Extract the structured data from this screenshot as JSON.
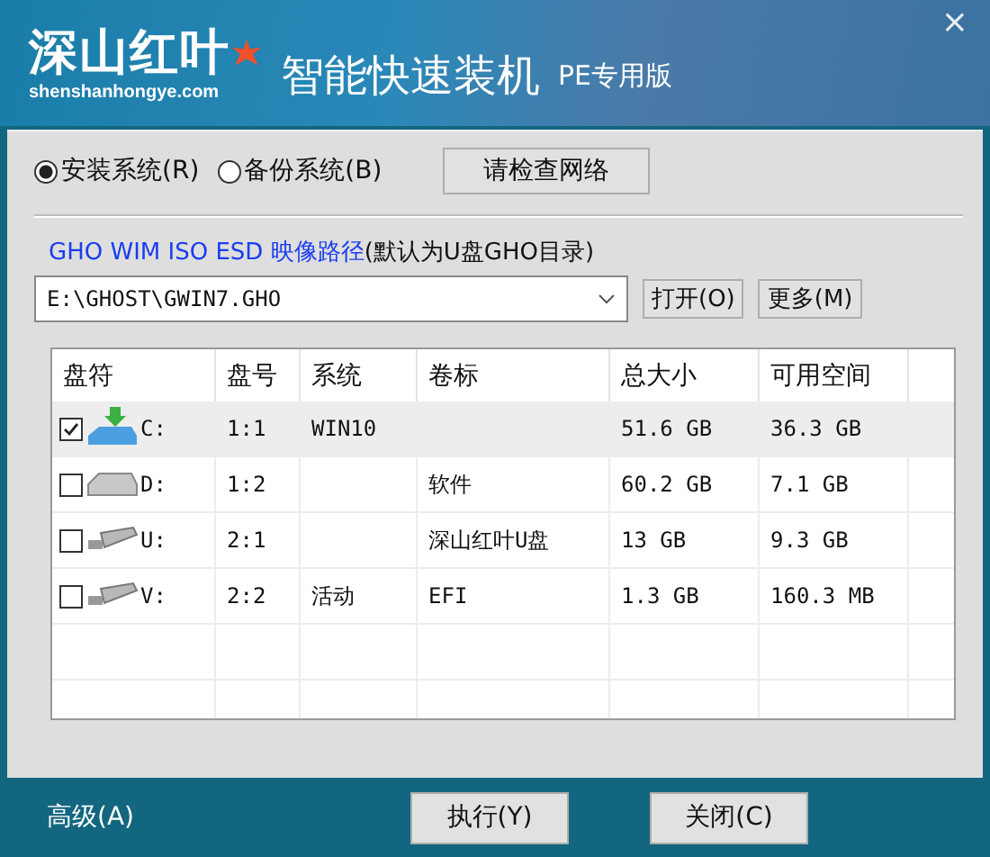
{
  "header": {
    "logo": "深山红叶",
    "website": "shenshanhongye.com",
    "title": "智能快速装机",
    "edition": "PE专用版",
    "close": "×"
  },
  "modes": [
    {
      "label": "安装系统(R)",
      "selected": true
    },
    {
      "label": "备份系统(B)",
      "selected": false
    }
  ],
  "network_button": "请检查网络",
  "path_label": "GHO WIM ISO ESD 映像路径",
  "path_hint": "(默认为U盘GHO目录)",
  "path_value": "E:\\GHOST\\GWIN7.GHO",
  "path_buttons": [
    "打开(O)",
    "更多(M)"
  ],
  "table": {
    "columns": [
      "盘符",
      "盘号",
      "系统",
      "卷标",
      "总大小",
      "可用空间"
    ],
    "rows": [
      {
        "checked": true,
        "selected": true,
        "kind": "install",
        "cells": [
          "C:",
          "1:1",
          "WIN10",
          "",
          "51.6 GB",
          "36.3 GB"
        ]
      },
      {
        "checked": false,
        "selected": false,
        "kind": "disk",
        "cells": [
          "D:",
          "1:2",
          "",
          "软件",
          "60.2 GB",
          "7.1 GB"
        ]
      },
      {
        "checked": false,
        "selected": false,
        "kind": "usb",
        "cells": [
          "U:",
          "2:1",
          "",
          "深山红叶U盘",
          "13 GB",
          "9.3 GB"
        ]
      },
      {
        "checked": false,
        "selected": false,
        "kind": "usb",
        "cells": [
          "V:",
          "2:2",
          "活动",
          "EFI",
          "1.3 GB",
          "160.3 MB"
        ]
      }
    ]
  },
  "footer": {
    "advanced": "高级(A)",
    "buttons": [
      "执行(Y)",
      "关闭(C)"
    ]
  }
}
